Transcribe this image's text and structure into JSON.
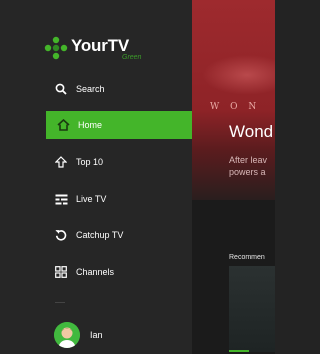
{
  "brand": {
    "name": "YourTV",
    "sub": "Green"
  },
  "nav": {
    "items": [
      {
        "label": "Search",
        "icon": "search-icon"
      },
      {
        "label": "Home",
        "icon": "home-icon",
        "active": true
      },
      {
        "label": "Top 10",
        "icon": "arrow-up-icon"
      },
      {
        "label": "Live TV",
        "icon": "live-tv-icon"
      },
      {
        "label": "Catchup TV",
        "icon": "catchup-icon"
      },
      {
        "label": "Channels",
        "icon": "channels-grid-icon"
      }
    ]
  },
  "profile": {
    "name": "Ian"
  },
  "hero": {
    "brand_text": "W O N",
    "title": "Wond",
    "description": "After leav\npowers a"
  },
  "section": {
    "label": "Recommen"
  },
  "colors": {
    "accent": "#44b52a",
    "sidebar": "#262626",
    "hero": "#9e2a2e"
  }
}
